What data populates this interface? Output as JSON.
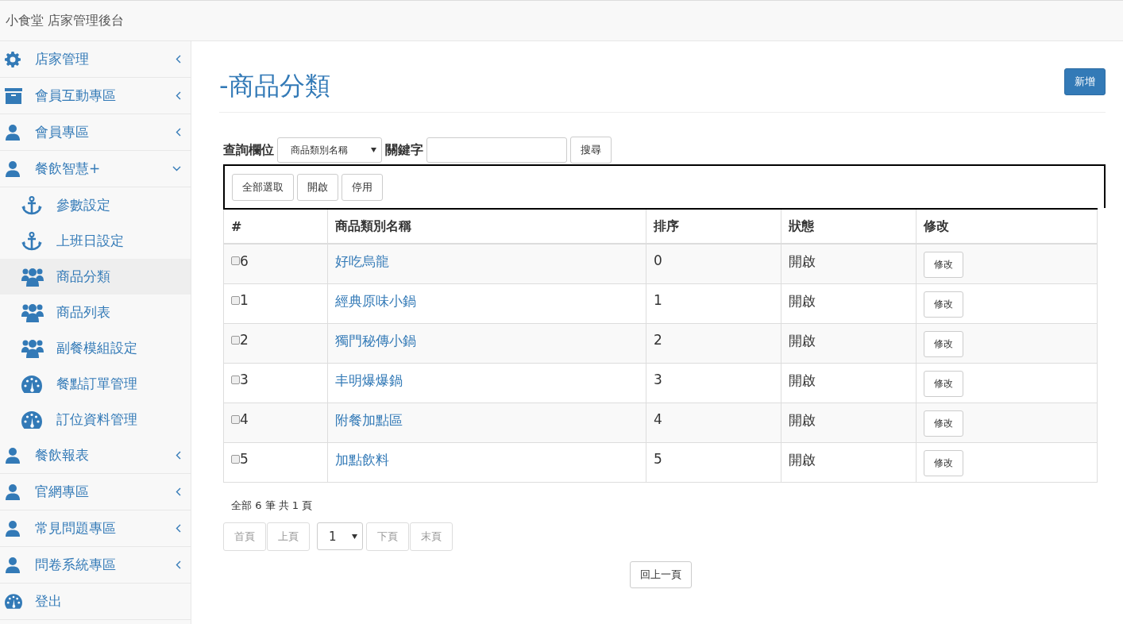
{
  "navbar": {
    "brand": "小食堂 店家管理後台"
  },
  "sidebar": {
    "items": [
      {
        "label": "店家管理",
        "kind": "gear",
        "expanded": false
      },
      {
        "label": "會員互動專區",
        "kind": "box",
        "expanded": false
      },
      {
        "label": "會員專區",
        "kind": "user",
        "expanded": false
      },
      {
        "label": "餐飲智慧+",
        "kind": "user",
        "expanded": true,
        "children": [
          {
            "label": "參數設定",
            "kind": "anchor",
            "selected": false
          },
          {
            "label": "上班日設定",
            "kind": "anchor",
            "selected": false
          },
          {
            "label": "商品分類",
            "kind": "users",
            "selected": true
          },
          {
            "label": "商品列表",
            "kind": "users",
            "selected": false
          },
          {
            "label": "副餐模組設定",
            "kind": "users",
            "selected": false
          },
          {
            "label": "餐點訂單管理",
            "kind": "gauge",
            "selected": false
          },
          {
            "label": "訂位資料管理",
            "kind": "gauge",
            "selected": false
          }
        ]
      },
      {
        "label": "餐飲報表",
        "kind": "user",
        "expanded": false
      },
      {
        "label": "官網專區",
        "kind": "user",
        "expanded": false
      },
      {
        "label": "常見問題專區",
        "kind": "user",
        "expanded": false
      },
      {
        "label": "問卷系統專區",
        "kind": "user",
        "expanded": false
      },
      {
        "label": "登出",
        "kind": "gauge"
      }
    ]
  },
  "page": {
    "title": "-商品分類",
    "new_button": "新增"
  },
  "search": {
    "field_label": "查詢欄位",
    "field_value": "商品類別名稱",
    "keyword_label": "關鍵字",
    "button": "搜尋"
  },
  "bulk_actions": [
    "全部選取",
    "開啟",
    "停用"
  ],
  "table": {
    "columns": [
      "#",
      "商品類別名稱",
      "排序",
      "狀態",
      "修改"
    ],
    "rows": [
      {
        "id": "6",
        "name": "好吃烏龍",
        "order": "0",
        "status": "開啟",
        "action": "修改",
        "checked": false
      },
      {
        "id": "1",
        "name": "經典原味小鍋",
        "order": "1",
        "status": "開啟",
        "action": "修改",
        "checked": false
      },
      {
        "id": "2",
        "name": "獨門秘傳小鍋",
        "order": "2",
        "status": "開啟",
        "action": "修改",
        "checked": false
      },
      {
        "id": "3",
        "name": "丰明爆爆鍋",
        "order": "3",
        "status": "開啟",
        "action": "修改",
        "checked": false
      },
      {
        "id": "4",
        "name": "附餐加點區",
        "order": "4",
        "status": "開啟",
        "action": "修改",
        "checked": false
      },
      {
        "id": "5",
        "name": "加點飲料",
        "order": "5",
        "status": "開啟",
        "action": "修改",
        "checked": false
      }
    ]
  },
  "pagination": {
    "summary": "全部 6 筆 共 1 頁",
    "first": {
      "label": "首頁",
      "disabled": true
    },
    "prev": {
      "label": "上頁",
      "disabled": true
    },
    "page_select": "1",
    "next": {
      "label": "下頁",
      "disabled": true
    },
    "last": {
      "label": "末頁",
      "disabled": true
    }
  },
  "back_button": "回上一頁"
}
